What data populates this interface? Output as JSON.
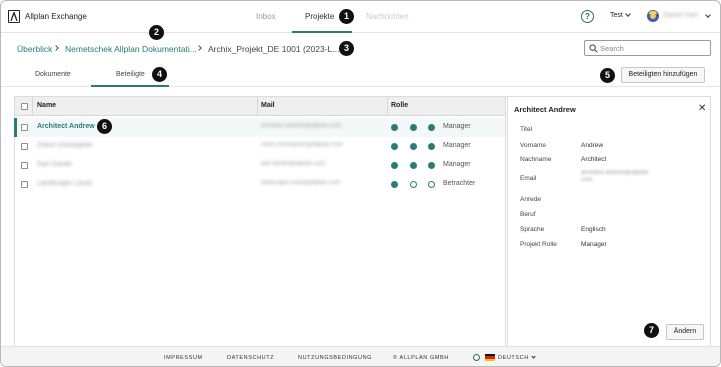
{
  "app": {
    "title": "Allplan Exchange"
  },
  "nav": {
    "tabs": [
      "Inbox",
      "Projekte",
      "Nachrichten"
    ],
    "active": "Projekte"
  },
  "header": {
    "workspace": "Test",
    "user": "Daniel Hart"
  },
  "badges": [
    "1",
    "2",
    "3",
    "4",
    "5",
    "6",
    "7"
  ],
  "breadcrumb": {
    "items": [
      "Überblick",
      "Nemetschek Allplan Dokumentati...",
      "Archix_Projekt_DE 1001 (2023-L..."
    ]
  },
  "search": {
    "placeholder": "Search"
  },
  "subtabs": {
    "items": [
      "Dokumente",
      "Beteiligte"
    ],
    "active": "Beteiligte"
  },
  "actions": {
    "add_participant": "Beteiligten hinzufügen",
    "edit": "Ändern"
  },
  "table": {
    "columns": [
      "Name",
      "Mail",
      "Rolle"
    ],
    "rows": [
      {
        "name": "Architect Andrew",
        "mail": "architect.andrew@allplan.com",
        "roles": [
          true,
          true,
          true
        ],
        "role": "Manager",
        "selected": true
      },
      {
        "name": "Client Christopher",
        "mail": "client.christopher@allplan.com",
        "roles": [
          true,
          true,
          true
        ],
        "role": "Manager",
        "selected": false
      },
      {
        "name": "Dan Daniel",
        "mail": "dan.daniel@allplan.com",
        "roles": [
          true,
          true,
          true
        ],
        "role": "Manager",
        "selected": false
      },
      {
        "name": "Landscape Lucas",
        "mail": "landscape.lucas@allplan.com",
        "roles": [
          true,
          false,
          false
        ],
        "role": "Betrachter",
        "selected": false
      }
    ]
  },
  "detail": {
    "title": "Architect Andrew",
    "fields": [
      {
        "label": "Titel",
        "value": ""
      },
      {
        "label": "Vorname",
        "value": "Andrew"
      },
      {
        "label": "Nachname",
        "value": "Architect"
      },
      {
        "label": "Email",
        "value": "architect.andrew@allplan.com"
      },
      {
        "label": "Anrede",
        "value": ""
      },
      {
        "label": "Beruf",
        "value": ""
      },
      {
        "label": "Sprache",
        "value": "Englisch"
      },
      {
        "label": "Projekt Rolle",
        "value": "Manager"
      }
    ]
  },
  "footer": {
    "links": [
      "IMPRESSUM",
      "DATENSCHUTZ",
      "NUTZUNGSBEDINGUNG",
      "© ALLPLAN GMBH"
    ],
    "language": "DEUTSCH"
  },
  "colors": {
    "accent": "#2a7a78",
    "badge": "#111111"
  }
}
